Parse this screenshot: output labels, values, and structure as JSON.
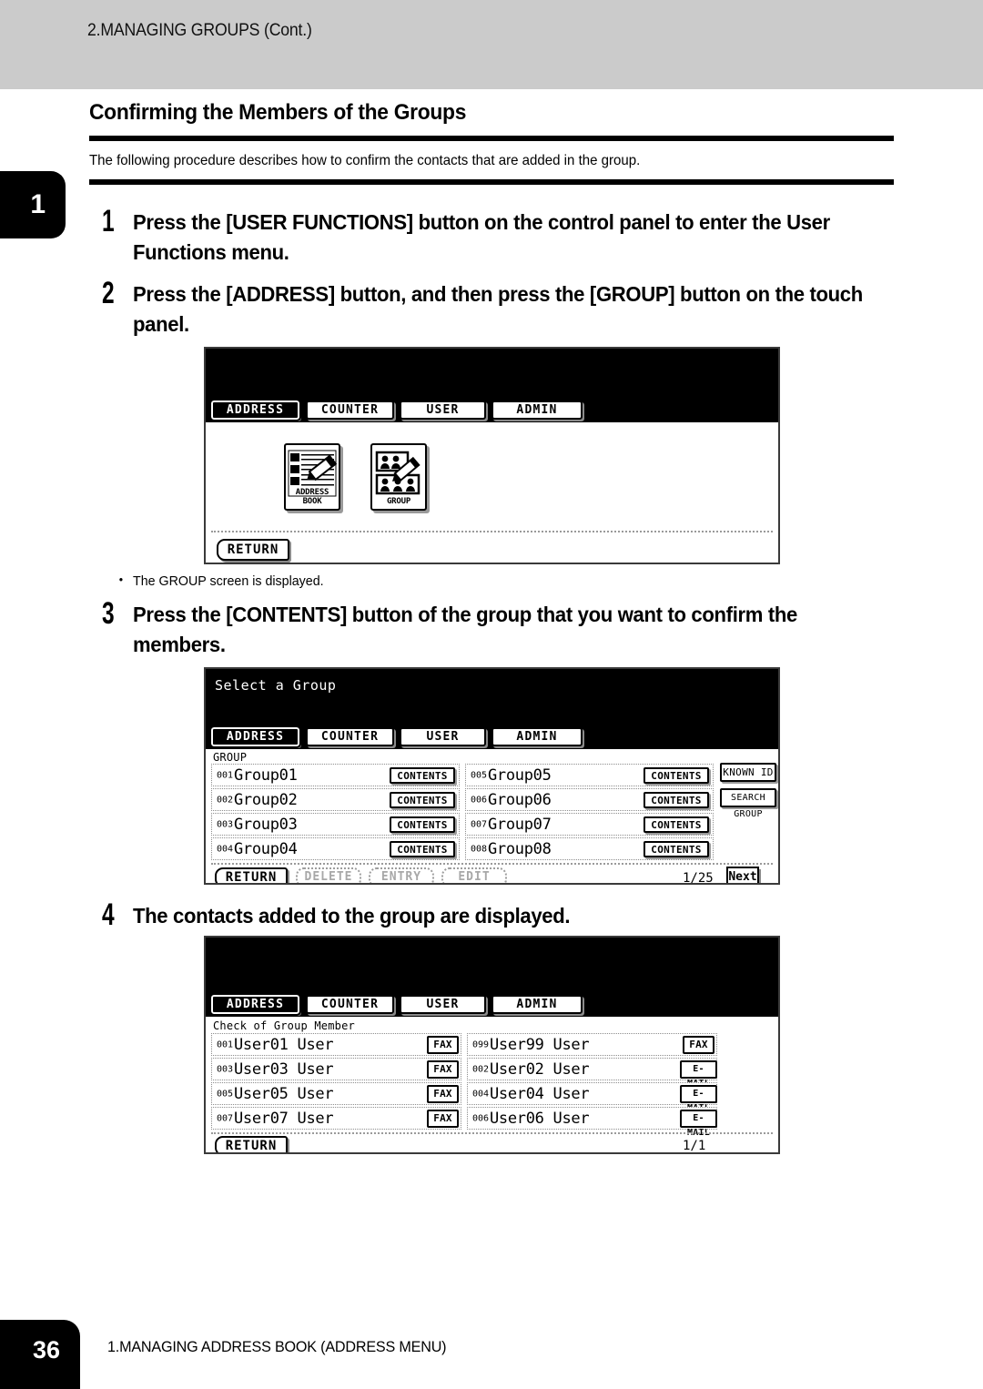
{
  "header": {
    "running_head": "2.MANAGING GROUPS (Cont.)",
    "chapter_tab_number": "1"
  },
  "section": {
    "title": "Confirming the Members of the Groups",
    "intro": "The following procedure describes how to confirm the contacts that are added in the group."
  },
  "steps": [
    {
      "number": "1",
      "text": "Press the [USER FUNCTIONS] button on the control panel to enter the User Functions menu."
    },
    {
      "number": "2",
      "text": "Press the [ADDRESS] button, and then press the [GROUP] button on the touch panel."
    },
    {
      "number": "3",
      "text": "Press the [CONTENTS] button of the group that you want to confirm the members."
    },
    {
      "number": "4",
      "text": "The contacts added to the group are displayed."
    }
  ],
  "notes": {
    "group_screen_displayed": "The GROUP screen is displayed."
  },
  "screen1": {
    "tabs": [
      {
        "label": "ADDRESS",
        "selected": true
      },
      {
        "label": "COUNTER",
        "selected": false
      },
      {
        "label": "USER",
        "selected": false
      },
      {
        "label": "ADMIN",
        "selected": false
      }
    ],
    "icons": [
      {
        "caption": "ADDRESS BOOK",
        "icon": "address-book-icon"
      },
      {
        "caption": "GROUP",
        "icon": "group-people-icon"
      }
    ],
    "return_label": "RETURN"
  },
  "screen2": {
    "title": "Select a Group",
    "tabs": [
      {
        "label": "ADDRESS",
        "selected": true
      },
      {
        "label": "COUNTER",
        "selected": false
      },
      {
        "label": "USER",
        "selected": false
      },
      {
        "label": "ADMIN",
        "selected": false
      }
    ],
    "list_label": "GROUP",
    "left_rows": [
      {
        "index": "001",
        "name": "Group01",
        "action": "CONTENTS"
      },
      {
        "index": "002",
        "name": "Group02",
        "action": "CONTENTS"
      },
      {
        "index": "003",
        "name": "Group03",
        "action": "CONTENTS"
      },
      {
        "index": "004",
        "name": "Group04",
        "action": "CONTENTS"
      }
    ],
    "right_rows": [
      {
        "index": "005",
        "name": "Group05",
        "action": "CONTENTS"
      },
      {
        "index": "006",
        "name": "Group06",
        "action": "CONTENTS"
      },
      {
        "index": "007",
        "name": "Group07",
        "action": "CONTENTS"
      },
      {
        "index": "008",
        "name": "Group08",
        "action": "CONTENTS"
      }
    ],
    "side_buttons": [
      {
        "label": "KNOWN ID"
      },
      {
        "label": "SEARCH GROUP"
      }
    ],
    "bottom_buttons": [
      {
        "label": "RETURN",
        "enabled": true
      },
      {
        "label": "DELETE",
        "enabled": false
      },
      {
        "label": "ENTRY",
        "enabled": false
      },
      {
        "label": "EDIT",
        "enabled": false
      }
    ],
    "page_indicator": "1/25",
    "next_label": "Next"
  },
  "screen3": {
    "tabs": [
      {
        "label": "ADDRESS",
        "selected": true
      },
      {
        "label": "COUNTER",
        "selected": false
      },
      {
        "label": "USER",
        "selected": false
      },
      {
        "label": "ADMIN",
        "selected": false
      }
    ],
    "list_label": "Check of Group Member",
    "left_rows": [
      {
        "index": "001",
        "name": "User01 User",
        "action": "FAX"
      },
      {
        "index": "003",
        "name": "User03 User",
        "action": "FAX"
      },
      {
        "index": "005",
        "name": "User05 User",
        "action": "FAX"
      },
      {
        "index": "007",
        "name": "User07 User",
        "action": "FAX"
      }
    ],
    "right_rows": [
      {
        "index": "099",
        "name": "User99 User",
        "action": "FAX"
      },
      {
        "index": "002",
        "name": "User02 User",
        "action": "E-MAIL"
      },
      {
        "index": "004",
        "name": "User04 User",
        "action": "E-MAIL"
      },
      {
        "index": "006",
        "name": "User06 User",
        "action": "E-MAIL"
      }
    ],
    "return_label": "RETURN",
    "page_indicator": "1/1"
  },
  "footer": {
    "page_number": "36",
    "running_foot": "1.MANAGING ADDRESS BOOK (ADDRESS MENU)"
  }
}
